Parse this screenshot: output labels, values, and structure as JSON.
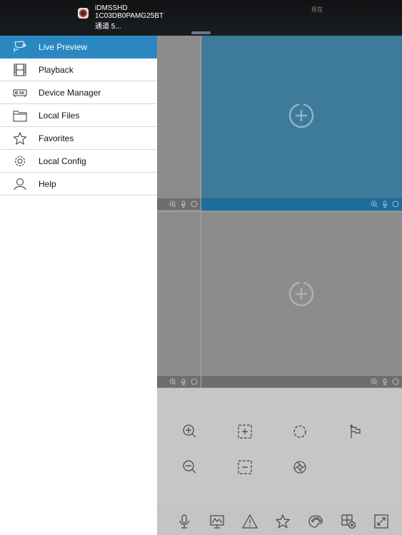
{
  "notification": {
    "app_name": "iDMSSHD",
    "device_id": "1C03DB0PAMG25BT",
    "message": "通道 5...",
    "time": "现在",
    "app_icon": "camera-app-icon"
  },
  "sidebar": {
    "items": [
      {
        "label": "Live Preview",
        "icon": "cctv-camera-icon",
        "active": true
      },
      {
        "label": "Playback",
        "icon": "film-strip-icon",
        "active": false
      },
      {
        "label": "Device Manager",
        "icon": "dvr-device-icon",
        "active": false
      },
      {
        "label": "Local Files",
        "icon": "folder-icon",
        "active": false
      },
      {
        "label": "Favorites",
        "icon": "star-icon",
        "active": false
      },
      {
        "label": "Local Config",
        "icon": "gear-icon",
        "active": false
      },
      {
        "label": "Help",
        "icon": "person-icon",
        "active": false
      }
    ]
  },
  "preview": {
    "colors": {
      "selected": "#3e7a9a",
      "selected_bar": "#1e6c99",
      "empty": "#8c8c8c",
      "empty_bar": "#6e6e6e"
    },
    "cells": [
      {
        "id": "cell-1",
        "selected": false
      },
      {
        "id": "cell-2",
        "selected": true
      },
      {
        "id": "cell-3",
        "selected": false
      },
      {
        "id": "cell-4",
        "selected": false
      }
    ],
    "cell_bar_icons": [
      "zoom-in-icon",
      "microphone-icon",
      "circle-icon"
    ]
  },
  "ptz": {
    "buttons": [
      "zoom-in-icon",
      "focus-plus-icon",
      "iris-open-icon",
      "preset-flag-icon",
      "zoom-out-icon",
      "focus-minus-icon",
      "iris-close-icon"
    ]
  },
  "bottom_toolbar": {
    "buttons": [
      "microphone-icon",
      "monitor-image-icon",
      "alarm-warning-icon",
      "favorite-star-icon",
      "palette-icon",
      "close-window-grid-icon",
      "fullscreen-expand-icon"
    ]
  }
}
